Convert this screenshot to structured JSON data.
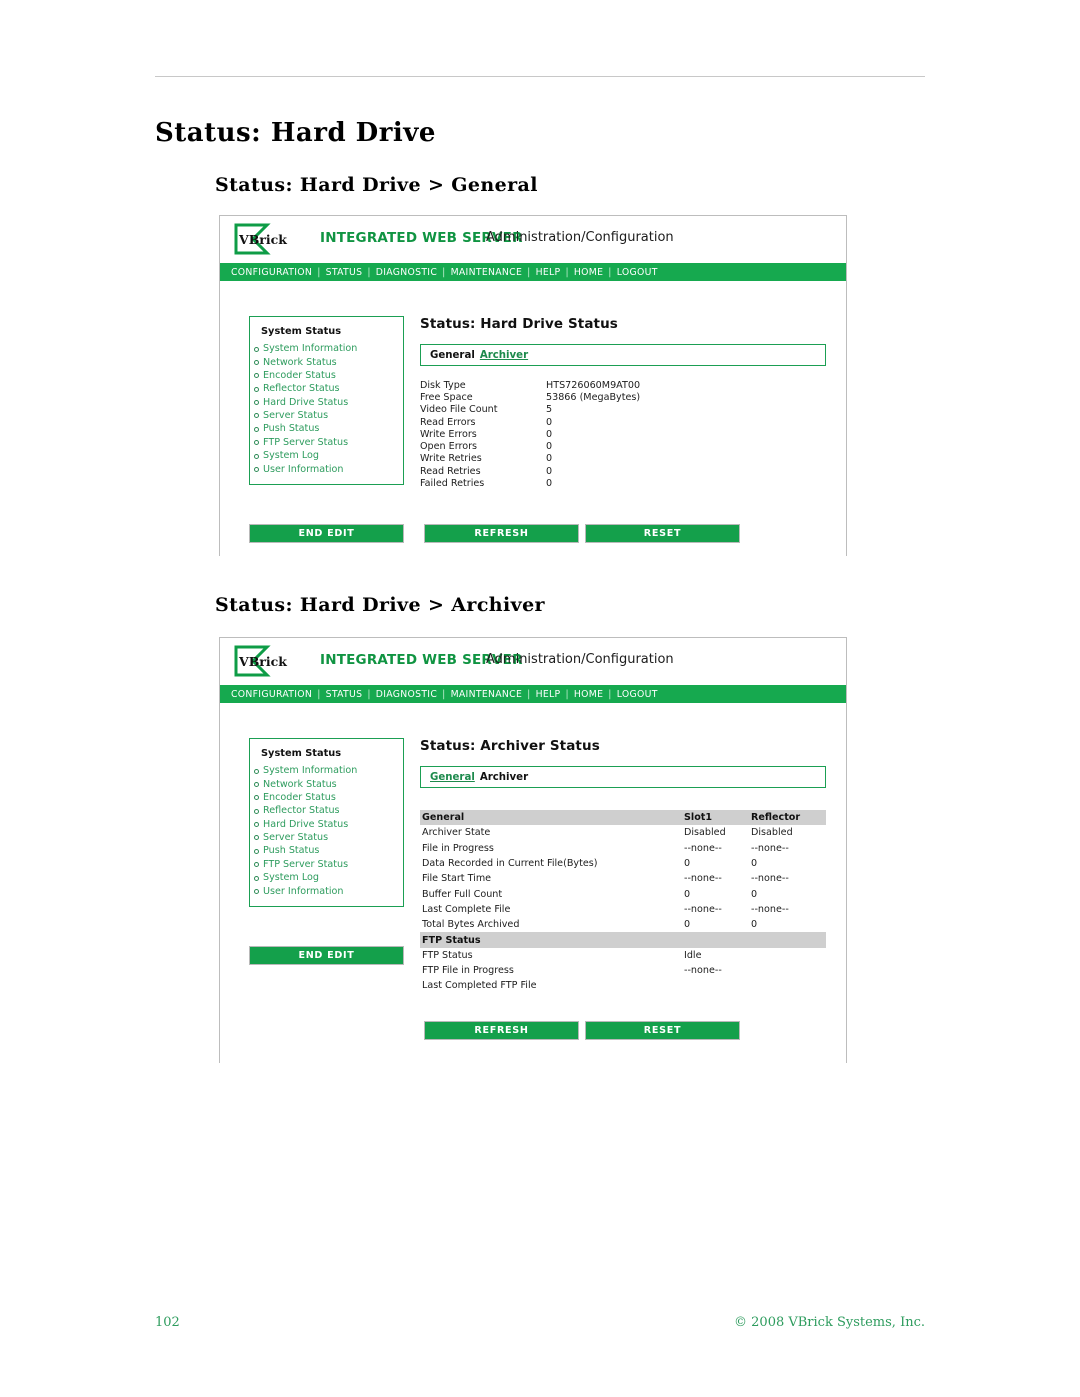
{
  "document": {
    "heading": "Status: Hard Drive",
    "section_general_heading": "Status: Hard Drive > General",
    "section_archiver_heading": "Status: Hard Drive > Archiver",
    "page_number": "102",
    "copyright": "© 2008 VBrick Systems, Inc."
  },
  "app": {
    "logo_text": "VBrick",
    "header_title": "INTEGRATED WEB SERVER",
    "header_subtitle": "Administration/Configuration",
    "nav": [
      "CONFIGURATION",
      "STATUS",
      "DIAGNOSTIC",
      "MAINTENANCE",
      "HELP",
      "HOME",
      "LOGOUT"
    ],
    "nav_separator": "|",
    "sidebar": {
      "title": "System Status",
      "items": [
        "System Information",
        "Network Status",
        "Encoder Status",
        "Reflector Status",
        "Hard Drive Status",
        "Server Status",
        "Push Status",
        "FTP Server Status",
        "System Log",
        "User Information"
      ]
    },
    "buttons": {
      "end_edit": "END EDIT",
      "refresh": "REFRESH",
      "reset": "RESET"
    },
    "colors": {
      "nav_green": "#16a94f",
      "button_green": "#14a04b",
      "link_green": "#2e9c5e",
      "header_green": "#109442",
      "table_header_gray": "#cfcfcf"
    }
  },
  "screen_general": {
    "title": "Status: Hard Drive Status",
    "tabs": {
      "active": "General",
      "link": "Archiver"
    },
    "rows": [
      {
        "key": "Disk Type",
        "value": "HTS726060M9AT00"
      },
      {
        "key": "Free Space",
        "value": "53866 (MegaBytes)"
      },
      {
        "key": "Video File Count",
        "value": "5"
      },
      {
        "key": "Read Errors",
        "value": "0"
      },
      {
        "key": "Write Errors",
        "value": "0"
      },
      {
        "key": "Open Errors",
        "value": "0"
      },
      {
        "key": "Write Retries",
        "value": "0"
      },
      {
        "key": "Read Retries",
        "value": "0"
      },
      {
        "key": "Failed Retries",
        "value": "0"
      }
    ]
  },
  "screen_archiver": {
    "title": "Status: Archiver Status",
    "tabs": {
      "link": "General",
      "active": "Archiver"
    },
    "table": {
      "header": {
        "c1": "General",
        "c2": "Slot1",
        "c3": "Reflector"
      },
      "rows": [
        {
          "c1": "Archiver State",
          "c2": "Disabled",
          "c3": "Disabled"
        },
        {
          "c1": "File in Progress",
          "c2": "--none--",
          "c3": "--none--"
        },
        {
          "c1": "Data Recorded in Current File(Bytes)",
          "c2": "0",
          "c3": "0"
        },
        {
          "c1": "File Start Time",
          "c2": "--none--",
          "c3": "--none--"
        },
        {
          "c1": "Buffer Full Count",
          "c2": "0",
          "c3": "0"
        },
        {
          "c1": "Last Complete File",
          "c2": "--none--",
          "c3": "--none--"
        },
        {
          "c1": "Total Bytes Archived",
          "c2": "0",
          "c3": "0"
        }
      ],
      "ftp_header": {
        "c1": "FTP Status",
        "c2": "",
        "c3": ""
      },
      "ftp_rows": [
        {
          "c1": "FTP Status",
          "c2": "Idle",
          "c3": ""
        },
        {
          "c1": "FTP File in Progress",
          "c2": "--none--",
          "c3": ""
        },
        {
          "c1": "Last Completed FTP File",
          "c2": "",
          "c3": ""
        }
      ]
    }
  }
}
